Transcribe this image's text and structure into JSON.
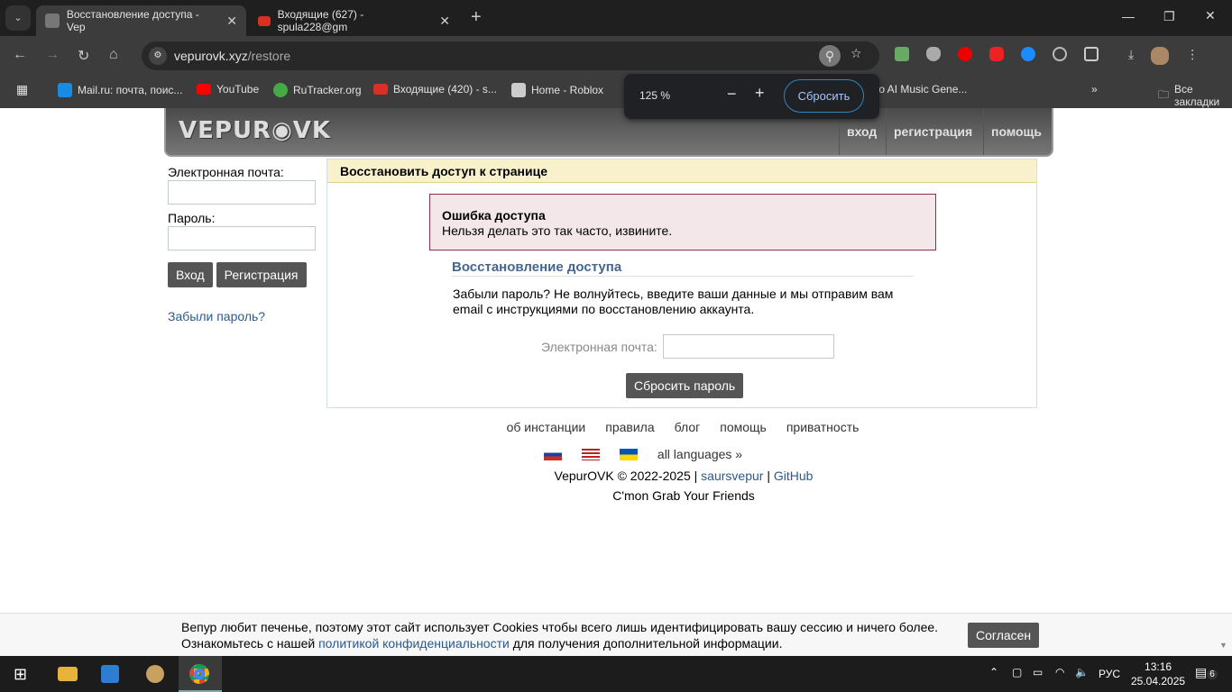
{
  "browser": {
    "tabs": [
      {
        "title": "Восстановление доступа - Vep",
        "active": true
      },
      {
        "title": "Входящие (627) - spula228@gm",
        "active": false
      }
    ],
    "url_host": "vepurovk.xyz",
    "url_path": "/restore",
    "bookmarks": [
      "Mail.ru: почта, поис...",
      "YouTube",
      "RuTracker.org",
      "Входящие (420) - s...",
      "Home - Roblox",
      "dio AI Music Gene..."
    ],
    "all_bookmarks": "Все закладки",
    "zoom": {
      "level": "125 %",
      "reset": "Сбросить"
    }
  },
  "site": {
    "logo": "VEPUROVK",
    "nav": [
      "вход",
      "регистрация",
      "помощь"
    ],
    "sidebar": {
      "email_label": "Электронная почта:",
      "password_label": "Пароль:",
      "login": "Вход",
      "register": "Регистрация",
      "forgot": "Забыли пароль?"
    },
    "main": {
      "header": "Восстановить доступ к странице",
      "error_title": "Ошибка доступа",
      "error_text": "Нельзя делать это так часто, извините.",
      "section_title": "Восстановление доступа",
      "intro": "Забыли пароль? Не волнуйтесь, введите ваши данные и мы отправим вам email с инструкциями по восстановлению аккаунта.",
      "email_label": "Электронная почта:",
      "email_value": "",
      "submit": "Сбросить пароль"
    },
    "footer": {
      "links": [
        "об инстанции",
        "правила",
        "блог",
        "помощь",
        "приватность"
      ],
      "all_languages": "all languages »",
      "copyright": "VepurOVK © 2022-2025",
      "author": "saursvepur",
      "github": "GitHub",
      "sep": "|",
      "tagline": "C'mon Grab Your Friends"
    },
    "cookie": {
      "text1": "Вепур любит печенье, поэтому этот сайт использует Cookies чтобы всего лишь идентифицировать вашу сессию и ничего более.",
      "text2a": "Ознакомьтесь с нашей ",
      "link": "политикой конфиденциальности",
      "text2b": " для получения дополнительной информации.",
      "accept": "Согласен"
    }
  },
  "taskbar": {
    "lang": "РУС",
    "time": "13:16",
    "date": "25.04.2025",
    "notifications": "6"
  }
}
